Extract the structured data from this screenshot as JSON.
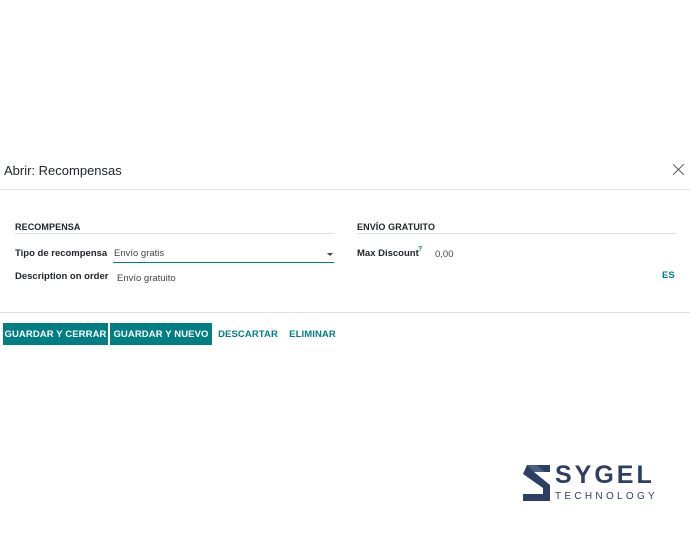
{
  "dialog": {
    "title": "Abrir: Recompensas"
  },
  "sections": {
    "reward_title": "RECOMPENSA",
    "free_shipping_title": "ENVÍO GRATUITO"
  },
  "fields": {
    "reward_type_label": "Tipo de recompensa",
    "reward_type_value": "Envío gratis",
    "description_label": "Description on order",
    "description_value": "Envío gratuito",
    "max_discount_label": "Max Discount",
    "max_discount_help": "?",
    "max_discount_value": "0,00",
    "language_code": "ES"
  },
  "buttons": {
    "save_close": "GUARDAR Y CERRAR",
    "save_new": "GUARDAR Y NUEVO",
    "discard": "DESCARTAR",
    "delete": "ELIMINAR"
  },
  "branding": {
    "logo_word": "SYGEL",
    "logo_sub": "TECHNOLOGY",
    "logo_color": "#2d3f63"
  },
  "colors": {
    "accent": "#017e84"
  }
}
